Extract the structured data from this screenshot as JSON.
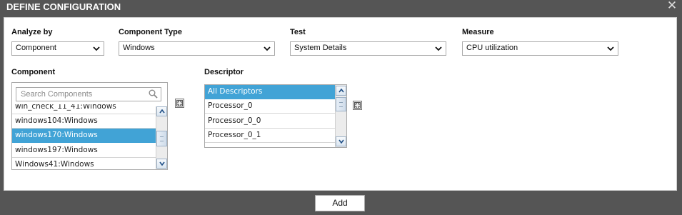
{
  "dialog": {
    "title": "DEFINE CONFIGURATION",
    "close_glyph": "✕"
  },
  "fields": {
    "analyze_by": {
      "label": "Analyze by",
      "value": "Component"
    },
    "component_type": {
      "label": "Component Type",
      "value": "Windows"
    },
    "test": {
      "label": "Test",
      "value": "System Details"
    },
    "measure": {
      "label": "Measure",
      "value": "CPU utilization"
    }
  },
  "component": {
    "label": "Component",
    "search_placeholder": "Search Components",
    "items": [
      "win_check_11_41:Windows",
      "windows104:Windows",
      "windows170:Windows",
      "windows197:Windows",
      "Windows41:Windows"
    ],
    "selected": "windows170:Windows"
  },
  "descriptor": {
    "label": "Descriptor",
    "items": [
      "All Descriptors",
      "Processor_0",
      "Processor_0_0",
      "Processor_0_1"
    ],
    "selected": "All Descriptors"
  },
  "actions": {
    "add_label": "Add"
  },
  "icons": {
    "close": "close-icon",
    "dropdown": "chevron-down-icon",
    "search": "search-icon",
    "expand": "expand-icon",
    "scroll_up": "scroll-up-icon",
    "scroll_down": "scroll-down-icon"
  },
  "colors": {
    "selection": "#41a3d6",
    "frame": "#555555"
  }
}
